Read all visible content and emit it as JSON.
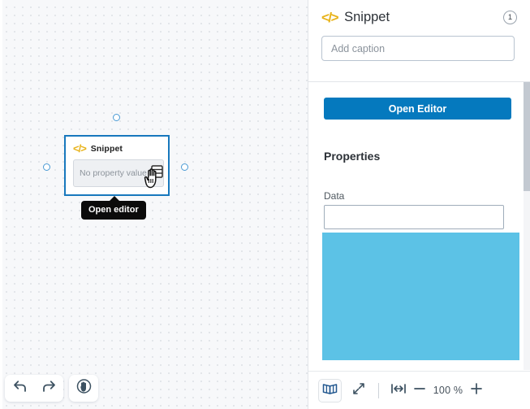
{
  "canvas": {
    "node": {
      "icon": "code-icon",
      "title": "Snippet",
      "field_placeholder": "No property value",
      "field_icon": "stack-icon",
      "cursor": "hand-pointer-cursor"
    },
    "tooltip": {
      "text": "Open editor"
    },
    "toolbar": {
      "undo_icon": "undo-arrow-icon",
      "redo_icon": "redo-arrow-icon",
      "pan_icon": "hand-pan-icon"
    },
    "handles": [
      "top-handle",
      "left-handle",
      "right-handle"
    ]
  },
  "panel": {
    "header": {
      "icon": "code-icon",
      "title": "Snippet",
      "badge": "1"
    },
    "caption": {
      "value": "",
      "placeholder": "Add caption"
    },
    "open_editor_label": "Open Editor",
    "properties_heading": "Properties",
    "fields": [
      {
        "label": "Data",
        "value": "",
        "placeholder": ""
      }
    ],
    "footer": {
      "spread_icon": "book-spread-icon",
      "expand_icon": "expand-diagonal-icon",
      "fit_width_icon": "fit-width-icon",
      "zoom_out_icon": "minus-icon",
      "zoom_level": "100 %",
      "zoom_in_icon": "plus-icon"
    }
  },
  "colors": {
    "accent_blue": "#0579be",
    "selection_blue": "#1878bd",
    "overlay_blue": "#5cc2e6",
    "code_icon_yellow": "#e8b31a",
    "tooltip_bg": "#0b0b0b"
  }
}
